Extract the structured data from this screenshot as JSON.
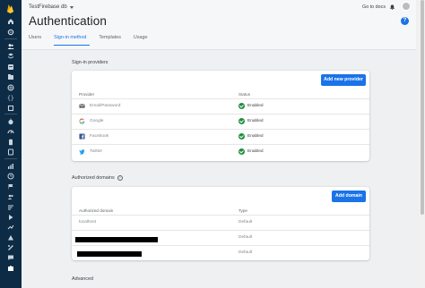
{
  "header": {
    "project_name": "TestFirebase db",
    "page_title": "Authentication",
    "go_to_docs": "Go to docs"
  },
  "tabs": [
    {
      "label": "Users",
      "active": false
    },
    {
      "label": "Sign-in method",
      "active": true
    },
    {
      "label": "Templates",
      "active": false
    },
    {
      "label": "Usage",
      "active": false
    }
  ],
  "providers": {
    "section_title": "Sign-in providers",
    "add_button": "Add new provider",
    "col_provider": "Provider",
    "col_status": "Status",
    "rows": [
      {
        "name": "Email/Password",
        "icon": "email-icon",
        "status": "Enabled"
      },
      {
        "name": "Google",
        "icon": "google-icon",
        "status": "Enabled"
      },
      {
        "name": "Facebook",
        "icon": "facebook-icon",
        "status": "Enabled"
      },
      {
        "name": "Twitter",
        "icon": "twitter-icon",
        "status": "Enabled"
      }
    ]
  },
  "domains": {
    "section_title": "Authorized domains",
    "add_button": "Add domain",
    "col_domain": "Authorized domain",
    "col_type": "Type",
    "rows": [
      {
        "name": "localhost",
        "type": "Default"
      },
      {
        "name": "",
        "type": "Default"
      },
      {
        "name": "",
        "type": "Default"
      }
    ]
  },
  "advanced": {
    "section_title": "Advanced"
  },
  "colors": {
    "rail": "#0d2b45",
    "accent": "#1a73e8",
    "enabled_green": "#1e8e3e"
  }
}
